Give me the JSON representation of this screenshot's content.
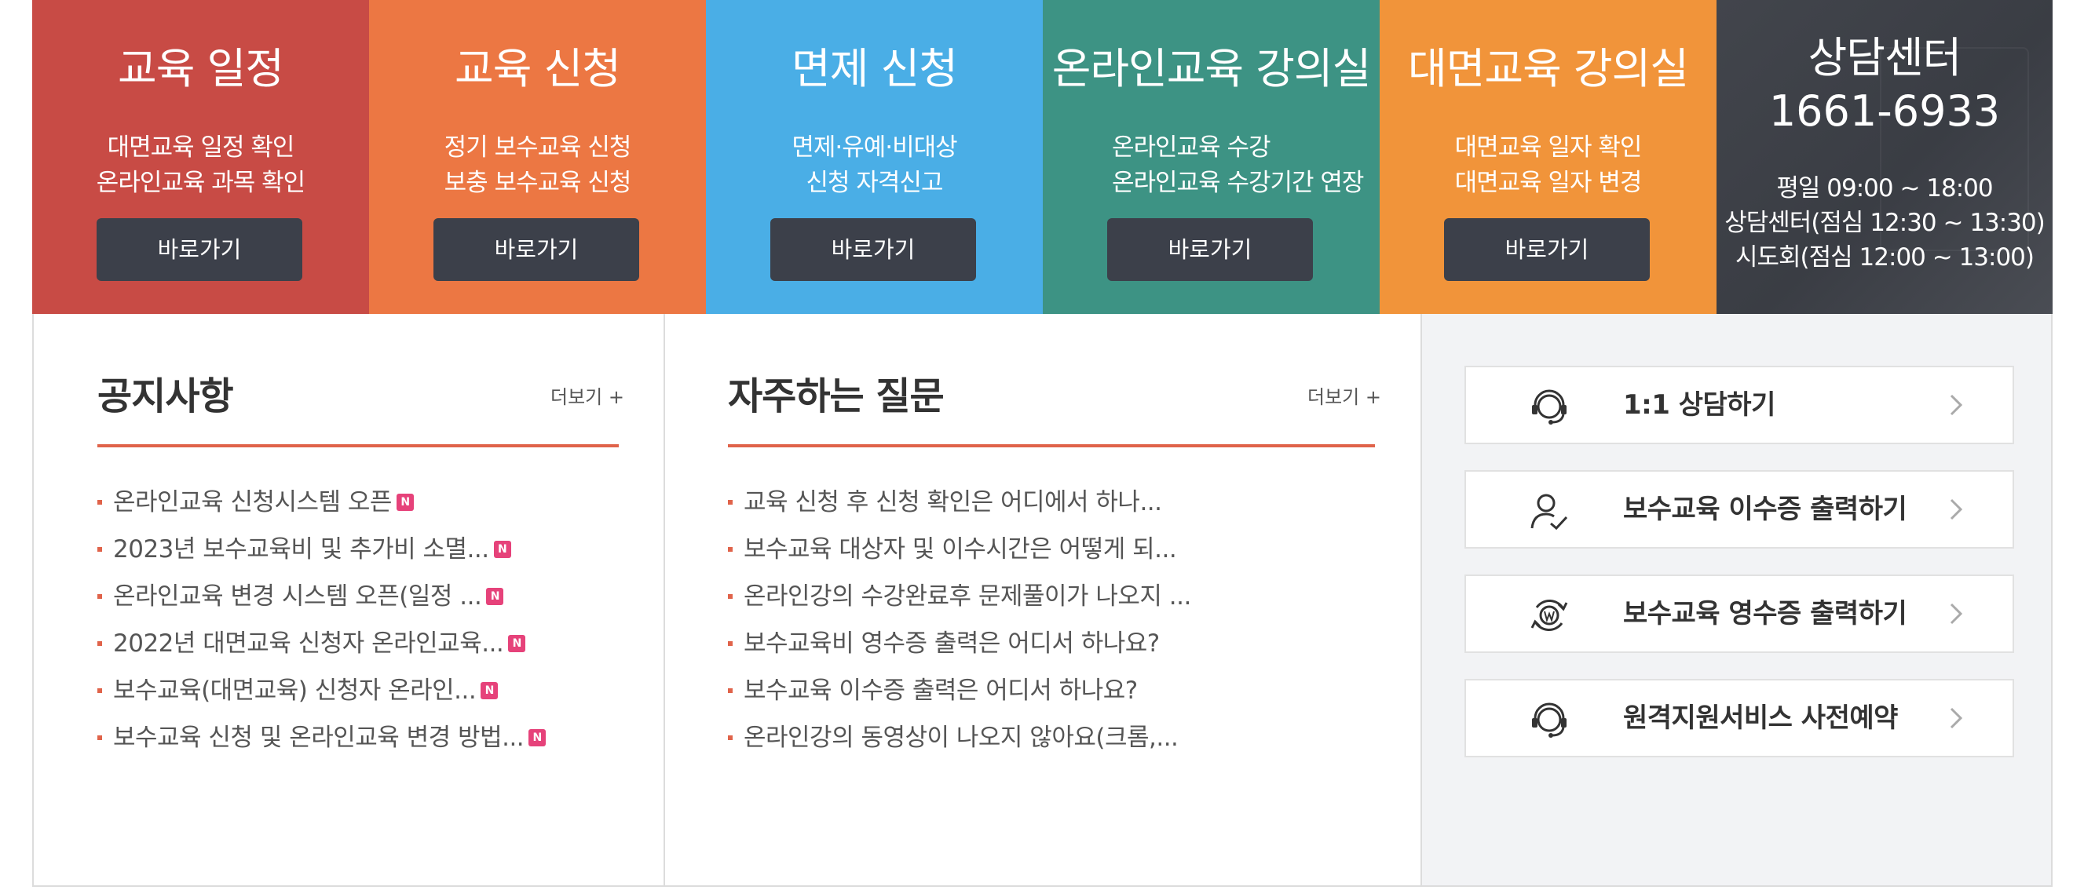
{
  "tiles": [
    {
      "title": "교육 일정",
      "lines": [
        "대면교육 일정 확인",
        "온라인교육 과목 확인"
      ],
      "button": "바로가기",
      "color": "#c84b45"
    },
    {
      "title": "교육 신청",
      "lines": [
        "정기 보수교육 신청",
        "보충 보수교육 신청"
      ],
      "button": "바로가기",
      "color": "#ec7743"
    },
    {
      "title": "면제 신청",
      "lines": [
        "면제·유예·비대상",
        "신청 자격신고"
      ],
      "button": "바로가기",
      "color": "#4aaee6"
    },
    {
      "title": "온라인교육 강의실",
      "lines": [
        "온라인교육 수강",
        "온라인교육 수강기간 연장"
      ],
      "button": "바로가기",
      "color": "#3d9384"
    },
    {
      "title": "대면교육 강의실",
      "lines": [
        "대면교육 일자 확인",
        "대면교육 일자 변경"
      ],
      "button": "바로가기",
      "color": "#f1943a"
    }
  ],
  "contact": {
    "title": "상담센터",
    "phone": "1661-6933",
    "hours": [
      "평일 09:00 ~ 18:00",
      "상담센터(점심 12:30 ~ 13:30)",
      "시도회(점심 12:00 ~ 13:00)"
    ],
    "color": "#3e4148"
  },
  "notice": {
    "title": "공지사항",
    "more": "더보기 +",
    "new_badge": "N",
    "items": [
      "온라인교육 신청시스템 오픈",
      "2023년 보수교육비 및 추가비 소멸...",
      "온라인교육 변경 시스템 오픈(일정 ...",
      "2022년 대면교육 신청자 온라인교육...",
      "보수교육(대면교육) 신청자 온라인...",
      "보수교육 신청 및 온라인교육 변경 방법..."
    ]
  },
  "faq": {
    "title": "자주하는 질문",
    "more": "더보기 +",
    "items": [
      "교육 신청 후 신청 확인은 어디에서 하나...",
      "보수교육 대상자 및 이수시간은 어떻게 되...",
      "온라인강의 수강완료후 문제풀이가 나오지 ...",
      "보수교육비 영수증 출력은 어디서 하나요?",
      "보수교육 이수증 출력은 어디서 하나요?",
      "온라인강의 동영상이 나오지 않아요(크롬,..."
    ]
  },
  "quick_links": [
    {
      "label": "1:1 상담하기",
      "icon": "headset-icon"
    },
    {
      "label": "보수교육 이수증 출력하기",
      "icon": "user-check-icon"
    },
    {
      "label": "보수교육 영수증 출력하기",
      "icon": "won-refresh-icon"
    },
    {
      "label": "원격지원서비스 사전예약",
      "icon": "headset-icon"
    }
  ],
  "colors": {
    "accent": "#e0634a",
    "badge": "#e6427a",
    "button": "#3c404a"
  }
}
